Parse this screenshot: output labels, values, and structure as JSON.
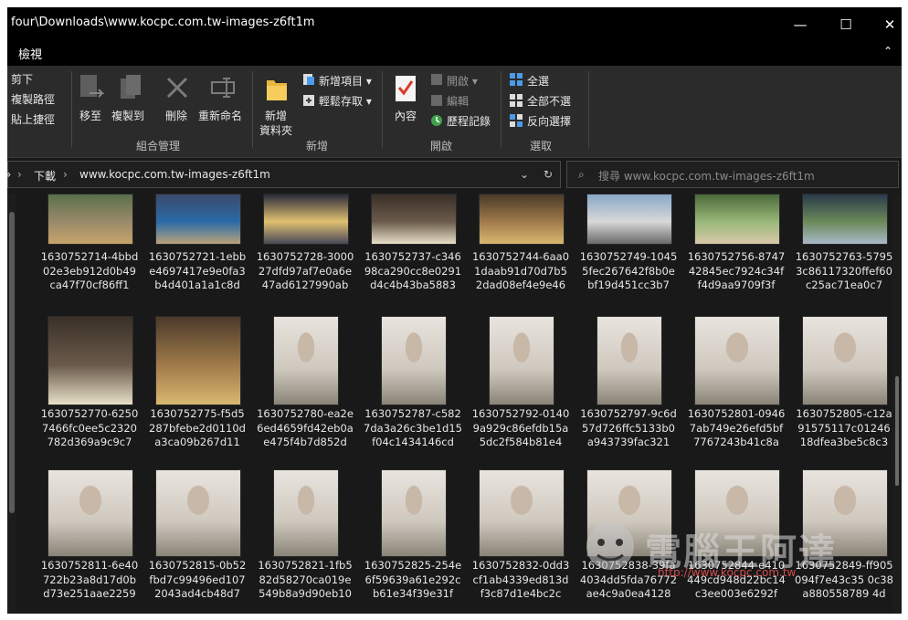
{
  "window": {
    "title": "four\\Downloads\\www.kocpc.com.tw-images-z6ft1m",
    "controls": [
      "—",
      "☐",
      "✕"
    ]
  },
  "menubar": {
    "tab_view": "檢視",
    "collapse": "⌃"
  },
  "ribbon": {
    "clipboard_partial": {
      "cut": "剪下",
      "copy_path": "複製路徑",
      "paste_shortcut": "貼上捷徑"
    },
    "organize": {
      "move_to": "移至",
      "copy_to": "複製到",
      "delete": "刪除",
      "rename": "重新命名",
      "group": "組合管理"
    },
    "new": {
      "new_folder_line1": "新增",
      "new_folder_line2": "資料夾",
      "new_item": "新增項目",
      "easy_access": "輕鬆存取",
      "group": "新增"
    },
    "open": {
      "properties": "內容",
      "open": "開啟",
      "edit": "編輯",
      "history": "歷程記錄",
      "group": "開啟"
    },
    "select": {
      "select_all": "全選",
      "select_none": "全部不選",
      "invert": "反向選擇",
      "group": "選取"
    }
  },
  "address": {
    "root_chevron": "»",
    "crumbs": [
      "下載",
      "www.kocpc.com.tw-images-z6ft1m"
    ],
    "search_placeholder": "搜尋 www.kocpc.com.tw-images-z6ft1m"
  },
  "files": {
    "row1": [
      {
        "name": "1630752714-4bbd02e3eb912d0b49ca47f70cf86ff1"
      },
      {
        "name": "1630752721-1ebbe4697417e9e0fa3b4d401a1a1c8d"
      },
      {
        "name": "1630752728-300027dfd97af7e0a6e47ad6127990ab"
      },
      {
        "name": "1630752737-c34698ca290cc8e0291d4c4b43ba5883"
      },
      {
        "name": "1630752744-6aa01daab91d70d7b52dad08ef4e9e46"
      },
      {
        "name": "1630752749-10455fec267642f8b0ebf19d451cc3b7"
      },
      {
        "name": "1630752756-874742845ec7924c34ff4d9aa9709f3f"
      },
      {
        "name": "1630752763-57953c86117320ffef60c25ac71ea0c7"
      }
    ],
    "row2": [
      {
        "name": "1630752770-62507466fc0ee5c2320782d369a9c9c7"
      },
      {
        "name": "1630752775-f5d5287bfebe2d0110da3ca09b267d11"
      },
      {
        "name": "1630752780-ea2e6ed4659fd42eb0ae475f4b7d852d"
      },
      {
        "name": "1630752787-c5827da3a26c3be1d15f04c1434146cd"
      },
      {
        "name": "1630752792-01409a929c86efdb15a5dc2f584b81e4"
      },
      {
        "name": "1630752797-9c6d57d726ffc5133b0a943739fac321"
      },
      {
        "name": "1630752801-09467ab749e26efd5bf7767243b41c8a"
      },
      {
        "name": "1630752805-c12a91575117c0124618dfea3be5c8c3"
      }
    ],
    "row3": [
      {
        "name": "1630752811-6e40722b23a8d17d0bd73e251aae2259"
      },
      {
        "name": "1630752815-0b52fbd7c99496ed1072043ad4cb48d7"
      },
      {
        "name": "1630752821-1fb582d58270ca019e549b8a9d90eb10"
      },
      {
        "name": "1630752825-254e6f59639a61e292cb61e34f39e31f"
      },
      {
        "name": "1630752832-0dd3cf1ab4339ed813df3c87d1e4bc2c"
      },
      {
        "name": "1630752838-39fa4034dd5fda76772ae4c9a0ea4128"
      },
      {
        "name": "1630752844-e410449cd948d22bc14c3ee003e6292f"
      },
      {
        "name": "1630752849-ff905094f7e43c35 0c38a880558789 4d"
      }
    ]
  },
  "watermark": {
    "text": "電腦王阿達",
    "url": "http://www.kocpc.com.tw"
  }
}
